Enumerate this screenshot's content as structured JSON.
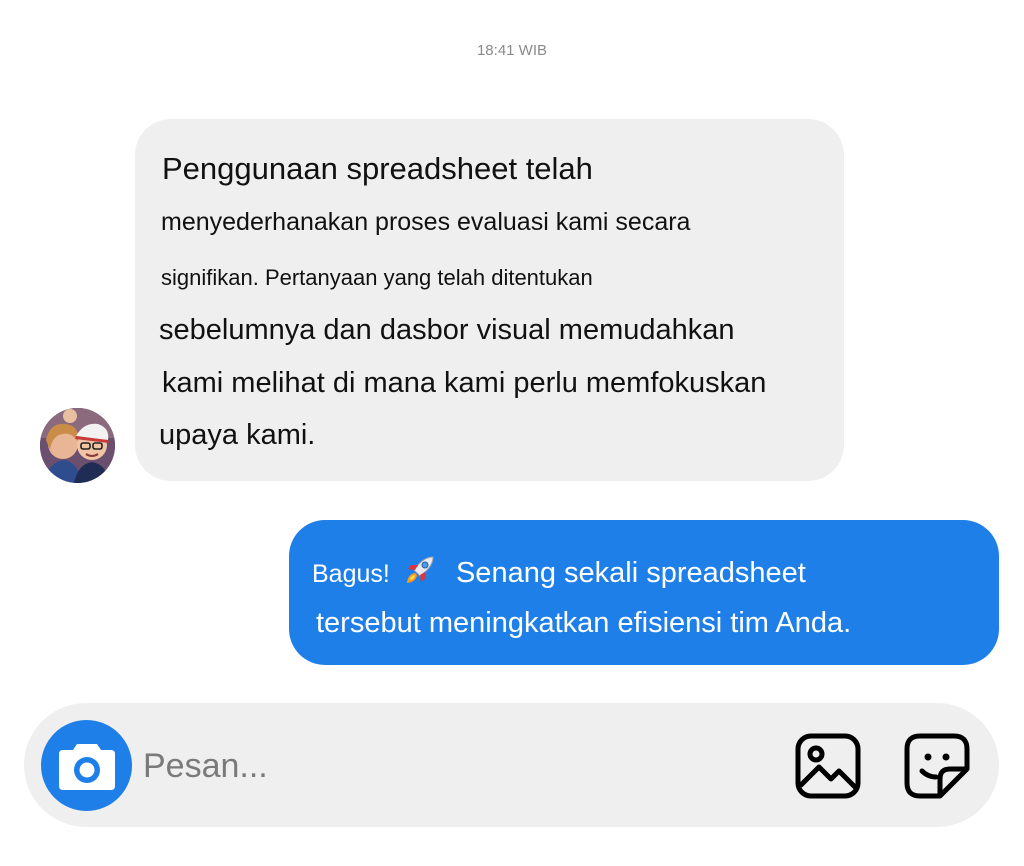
{
  "timestamp": "18:41 WIB",
  "incoming": {
    "lines": [
      "Penggunaan spreadsheet telah",
      "menyederhanakan proses evaluasi kami secara",
      "signifikan. Pertanyaan yang telah ditentukan",
      "sebelumnya dan dasbor visual memudahkan",
      "kami melihat di mana kami perlu memfokuskan",
      "upaya kami."
    ],
    "avatar_icon": "user-avatar-photo",
    "bubble_color": "#efefef"
  },
  "outgoing": {
    "line1_prefix": "Bagus!",
    "emoji": "rocket-emoji",
    "line1_suffix": "Senang sekali spreadsheet",
    "line2": "tersebut meningkatkan efisiensi tim Anda.",
    "bubble_color": "#1f7fe9"
  },
  "composer": {
    "placeholder": "Pesan...",
    "camera_icon": "camera-icon",
    "gallery_icon": "image-gallery-icon",
    "sticker_icon": "sticker-icon",
    "accent_color": "#1f7fe9"
  }
}
